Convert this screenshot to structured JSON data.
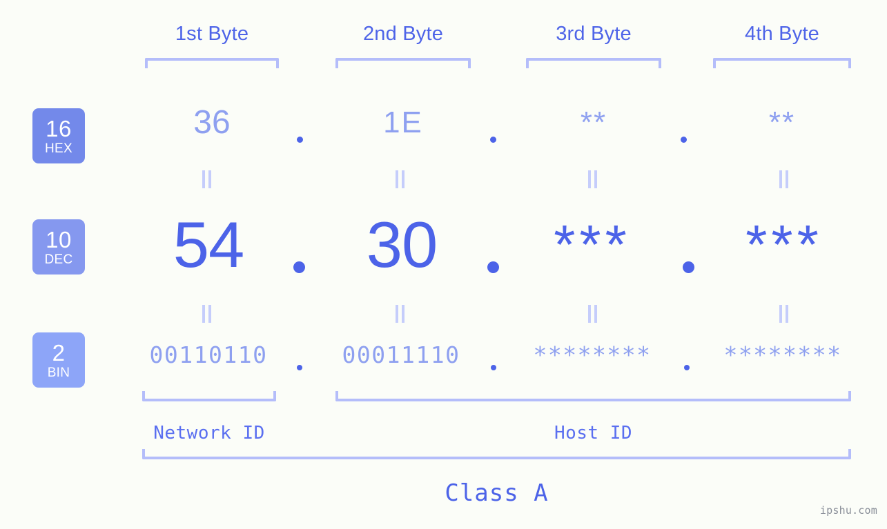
{
  "meta": {
    "watermark": "ipshu.com",
    "accent_dark": "#4c63e8",
    "accent_mid": "#8ea0f0",
    "accent_light": "#b4bdfa",
    "background": "#fbfdf8"
  },
  "headers": {
    "byte1": "1st Byte",
    "byte2": "2nd Byte",
    "byte3": "3rd Byte",
    "byte4": "4th Byte"
  },
  "bases": [
    {
      "number": "16",
      "name": "HEX",
      "color": "#7389ea"
    },
    {
      "number": "10",
      "name": "DEC",
      "color": "#8598ef"
    },
    {
      "number": "2",
      "name": "BIN",
      "color": "#8da5f8"
    }
  ],
  "rows": {
    "hex": {
      "b1": "36",
      "b2": "1E",
      "b3": "**",
      "b4": "**"
    },
    "dec": {
      "b1": "54",
      "b2": "30",
      "b3": "***",
      "b4": "***"
    },
    "bin": {
      "b1": "00110110",
      "b2": "00011110",
      "b3": "********",
      "b4": "********"
    }
  },
  "separators": {
    "dot": "."
  },
  "footer": {
    "network_id": "Network ID",
    "host_id": "Host ID",
    "class": "Class A"
  }
}
